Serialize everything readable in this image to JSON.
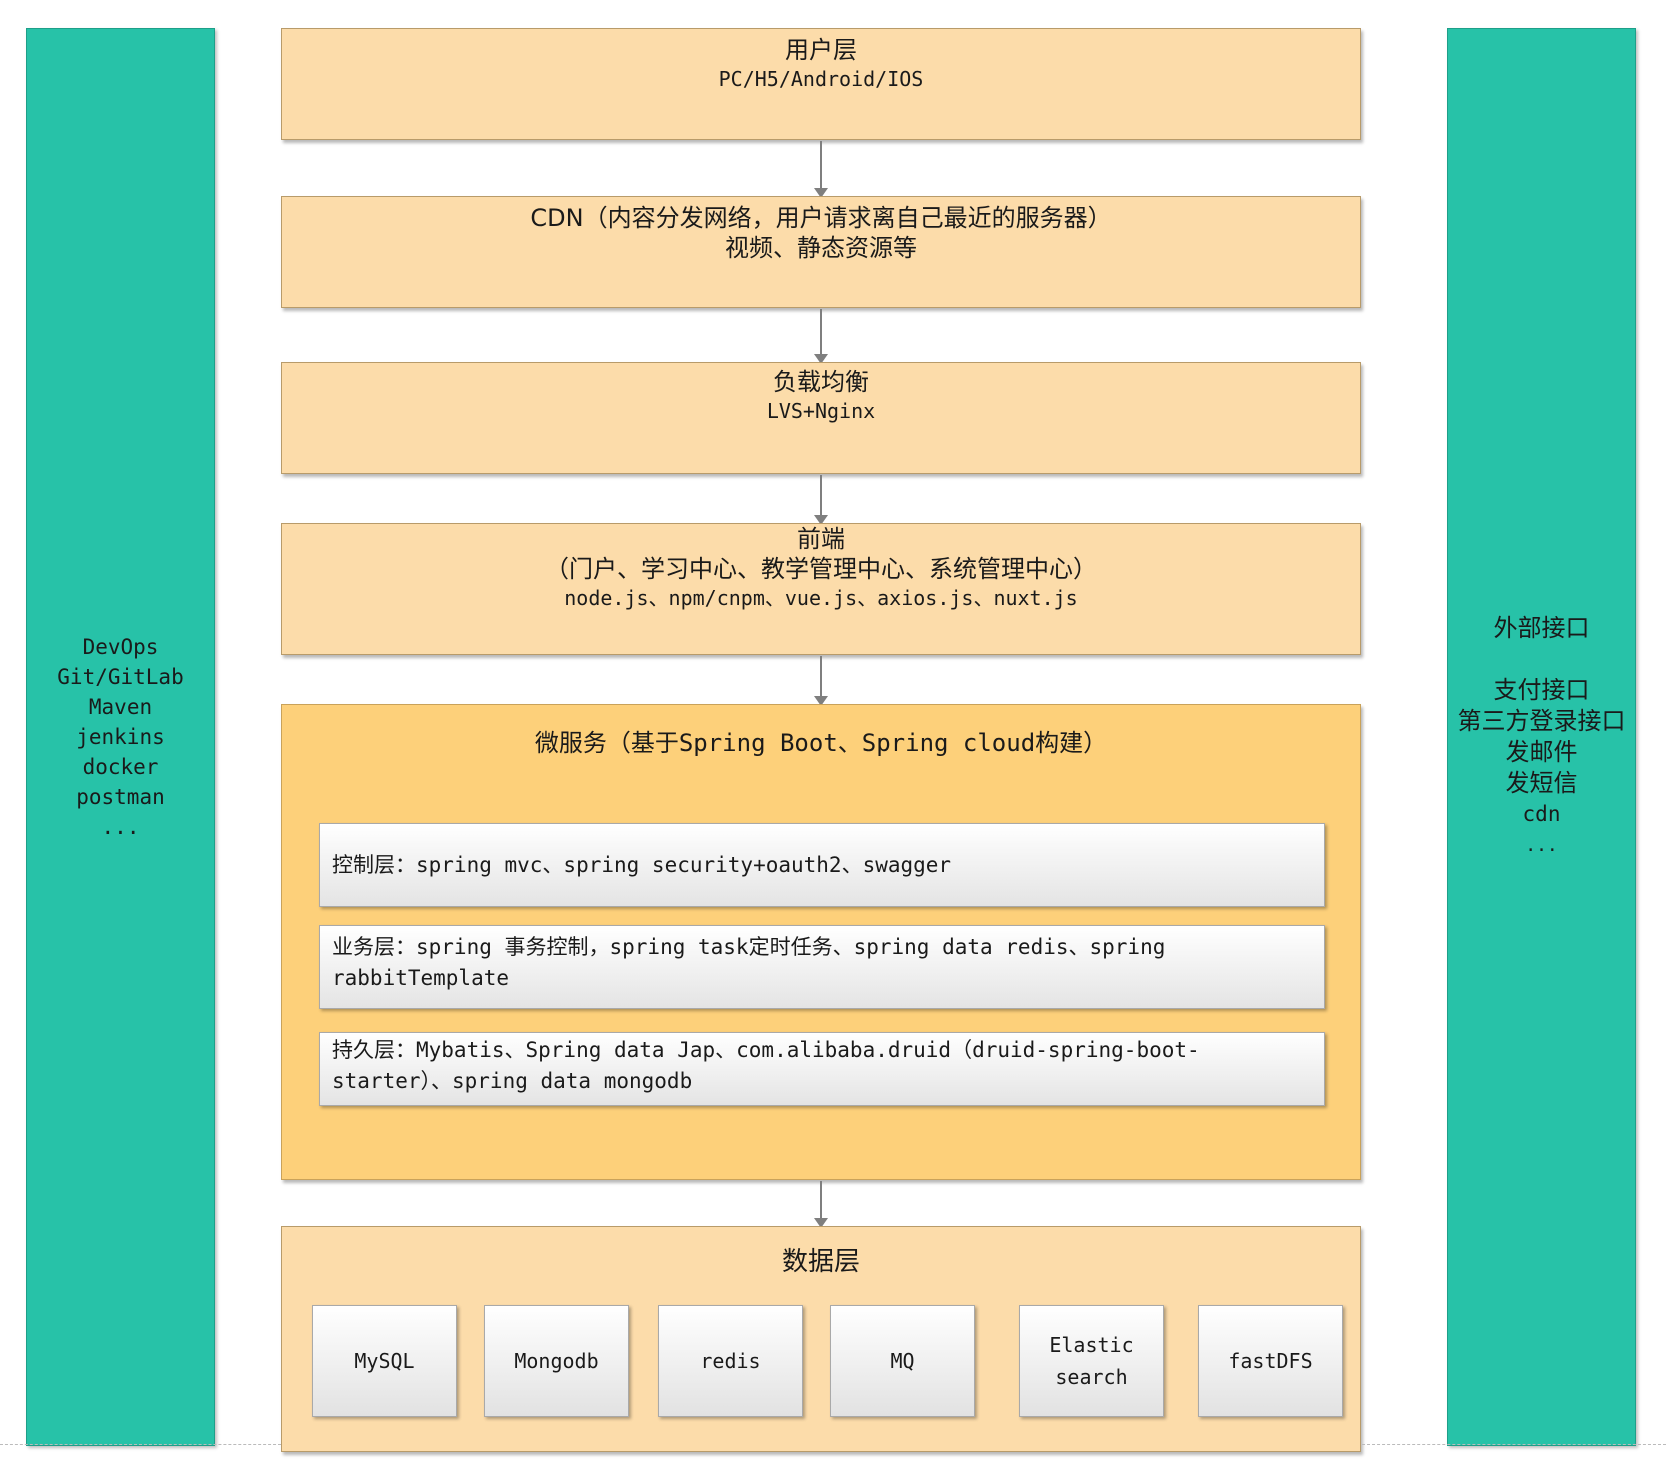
{
  "left_panel": {
    "lines": [
      "DevOps",
      "Git/GitLab",
      "Maven",
      "jenkins",
      "docker",
      "postman",
      "..."
    ]
  },
  "right_panel": {
    "lines": [
      "外部接口",
      "",
      "支付接口",
      "第三方登录接口",
      "发邮件",
      "发短信",
      "cdn",
      "..."
    ]
  },
  "user_layer": {
    "title": "用户层",
    "sub": "PC/H5/Android/IOS"
  },
  "cdn_layer": {
    "title": "CDN（内容分发网络，用户请求离自己最近的服务器）",
    "sub": "视频、静态资源等"
  },
  "lb_layer": {
    "title": "负载均衡",
    "sub": "LVS+Nginx"
  },
  "frontend_layer": {
    "title": "前端",
    "line2": "（门户、学习中心、教学管理中心、系统管理中心）",
    "sub": "node.js、npm/cnpm、vue.js、axios.js、nuxt.js"
  },
  "microservice": {
    "title": "微服务（基于Spring Boot、Spring cloud构建）",
    "control": "控制层：spring mvc、spring security+oauth2、swagger",
    "business": "业务层：spring 事务控制，spring task定时任务、spring data redis、spring rabbitTemplate",
    "persistence": "持久层：Mybatis、Spring data Jap、com.alibaba.druid（druid-spring-boot-starter）、spring data mongodb"
  },
  "data_layer": {
    "title": "数据层",
    "stores": [
      "MySQL",
      "Mongodb",
      "redis",
      "MQ",
      "Elastic search",
      "fastDFS"
    ]
  }
}
